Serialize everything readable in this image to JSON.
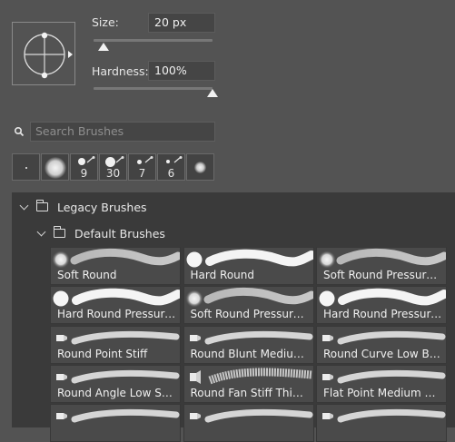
{
  "size": {
    "label": "Size:",
    "value": "20 px"
  },
  "hardness": {
    "label": "Hardness:",
    "value": "100%"
  },
  "search": {
    "placeholder": "Search Brushes"
  },
  "recent_presets": [
    {
      "size_label": ""
    },
    {
      "size_label": ""
    },
    {
      "size_label": "9"
    },
    {
      "size_label": "30"
    },
    {
      "size_label": "7"
    },
    {
      "size_label": "6"
    },
    {
      "size_label": ""
    }
  ],
  "folders": {
    "legacy": "Legacy Brushes",
    "default": "Default Brushes"
  },
  "brushes": [
    {
      "name": "Soft Round",
      "icon": "soft-round"
    },
    {
      "name": "Hard Round",
      "icon": "hard-round"
    },
    {
      "name": "Soft Round Pressure S...",
      "icon": "soft-round"
    },
    {
      "name": "Hard Round Pressure...",
      "icon": "hard-round"
    },
    {
      "name": "Soft Round Pressure O...",
      "icon": "soft-round"
    },
    {
      "name": "Hard Round Pressure...",
      "icon": "hard-round"
    },
    {
      "name": "Round Point Stiff",
      "icon": "bristle"
    },
    {
      "name": "Round Blunt Medium...",
      "icon": "bristle"
    },
    {
      "name": "Round Curve Low Bris...",
      "icon": "bristle"
    },
    {
      "name": "Round Angle Low Stiff...",
      "icon": "bristle"
    },
    {
      "name": "Round Fan Stiff Thin B...",
      "icon": "fan"
    },
    {
      "name": "Flat Point Medium Stiff",
      "icon": "bristle"
    },
    {
      "name": "",
      "icon": "bristle"
    },
    {
      "name": "",
      "icon": "bristle"
    },
    {
      "name": "",
      "icon": "bristle"
    }
  ]
}
